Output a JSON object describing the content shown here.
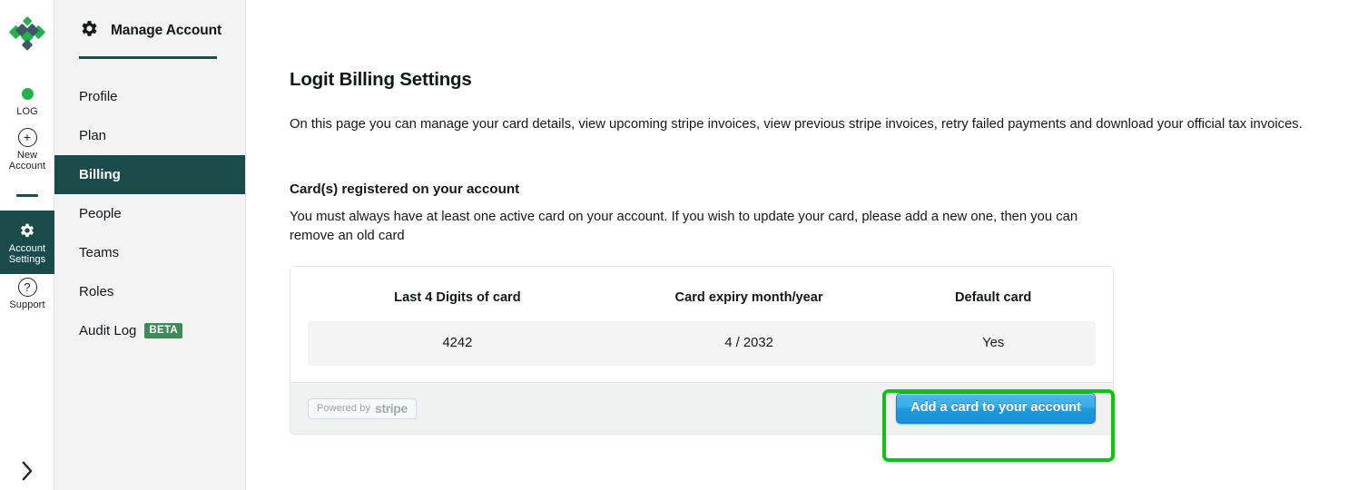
{
  "rail": {
    "logo_icon": "logit-diamond-logo",
    "items": [
      {
        "id": "log",
        "label": "LOG",
        "icon": "green-dot-icon"
      },
      {
        "id": "new-account",
        "label": "New\nAccount",
        "label_line1": "New",
        "label_line2": "Account",
        "icon": "plus-circle-icon"
      },
      {
        "id": "account-settings",
        "label_line1": "Account",
        "label_line2": "Settings",
        "icon": "gear-icon",
        "active": true
      },
      {
        "id": "support",
        "label": "Support",
        "icon": "question-circle-icon"
      }
    ],
    "expand_icon": "chevron-right-icon"
  },
  "nav": {
    "header_icon": "gear-icon",
    "header_title": "Manage Account",
    "items": [
      {
        "label": "Profile",
        "active": false
      },
      {
        "label": "Plan",
        "active": false
      },
      {
        "label": "Billing",
        "active": true
      },
      {
        "label": "People",
        "active": false
      },
      {
        "label": "Teams",
        "active": false
      },
      {
        "label": "Roles",
        "active": false
      },
      {
        "label": "Audit Log",
        "active": false,
        "badge": "BETA"
      }
    ]
  },
  "main": {
    "page_title": "Logit Billing Settings",
    "page_description": "On this page you can manage your card details, view upcoming stripe invoices, view previous stripe invoices, retry failed payments and download your official tax invoices.",
    "section_title": "Card(s) registered on your account",
    "section_description": "You must always have at least one active card on your account. If you wish to update your card, please add a new one, then you can remove an old card",
    "table": {
      "columns": [
        "Last 4 Digits of card",
        "Card expiry month/year",
        "Default card"
      ],
      "rows": [
        [
          "4242",
          "4 / 2032",
          "Yes"
        ]
      ]
    },
    "footer": {
      "stripe_powered_by": "Powered by",
      "stripe_wordmark": "stripe",
      "add_card_button": "Add a card to your account"
    }
  },
  "colors": {
    "nav_active_bg": "#1a4a4a",
    "rail_active_bg": "#1a4a4a",
    "beta_badge_bg": "#3f8a58",
    "logo_green": "#22b24c",
    "logo_slate": "#3d5a66",
    "annotation_green": "#0ec40e",
    "button_blue": "#1c9ade"
  }
}
